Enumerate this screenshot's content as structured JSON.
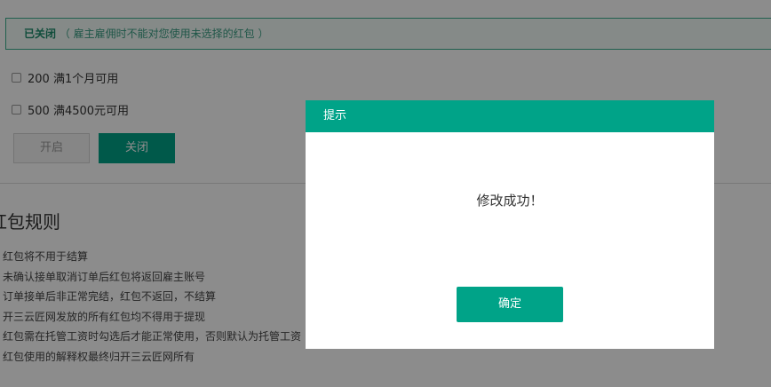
{
  "status": {
    "label": "已关闭",
    "note": "（ 雇主雇佣时不能对您使用未选择的红包 ）"
  },
  "coupons": [
    {
      "label": "200 满1个月可用",
      "checked": false
    },
    {
      "label": "500 满4500元可用",
      "checked": false
    }
  ],
  "buttons": {
    "open": "开启",
    "close": "关闭"
  },
  "rules": {
    "title": "红包规则",
    "items": [
      "红包将不用于结算",
      "未确认接单取消订单后红包将返回雇主账号",
      "订单接单后非正常完结，红包不返回，不结算",
      "开三云匠网发放的所有红包均不得用于提现",
      "红包需在托管工资时勾选后才能正常使用，否则默认为托管工资",
      "红包使用的解释权最终归开三云匠网所有"
    ]
  },
  "dialog": {
    "title": "提示",
    "message": "修改成功！",
    "confirm": "确定"
  }
}
